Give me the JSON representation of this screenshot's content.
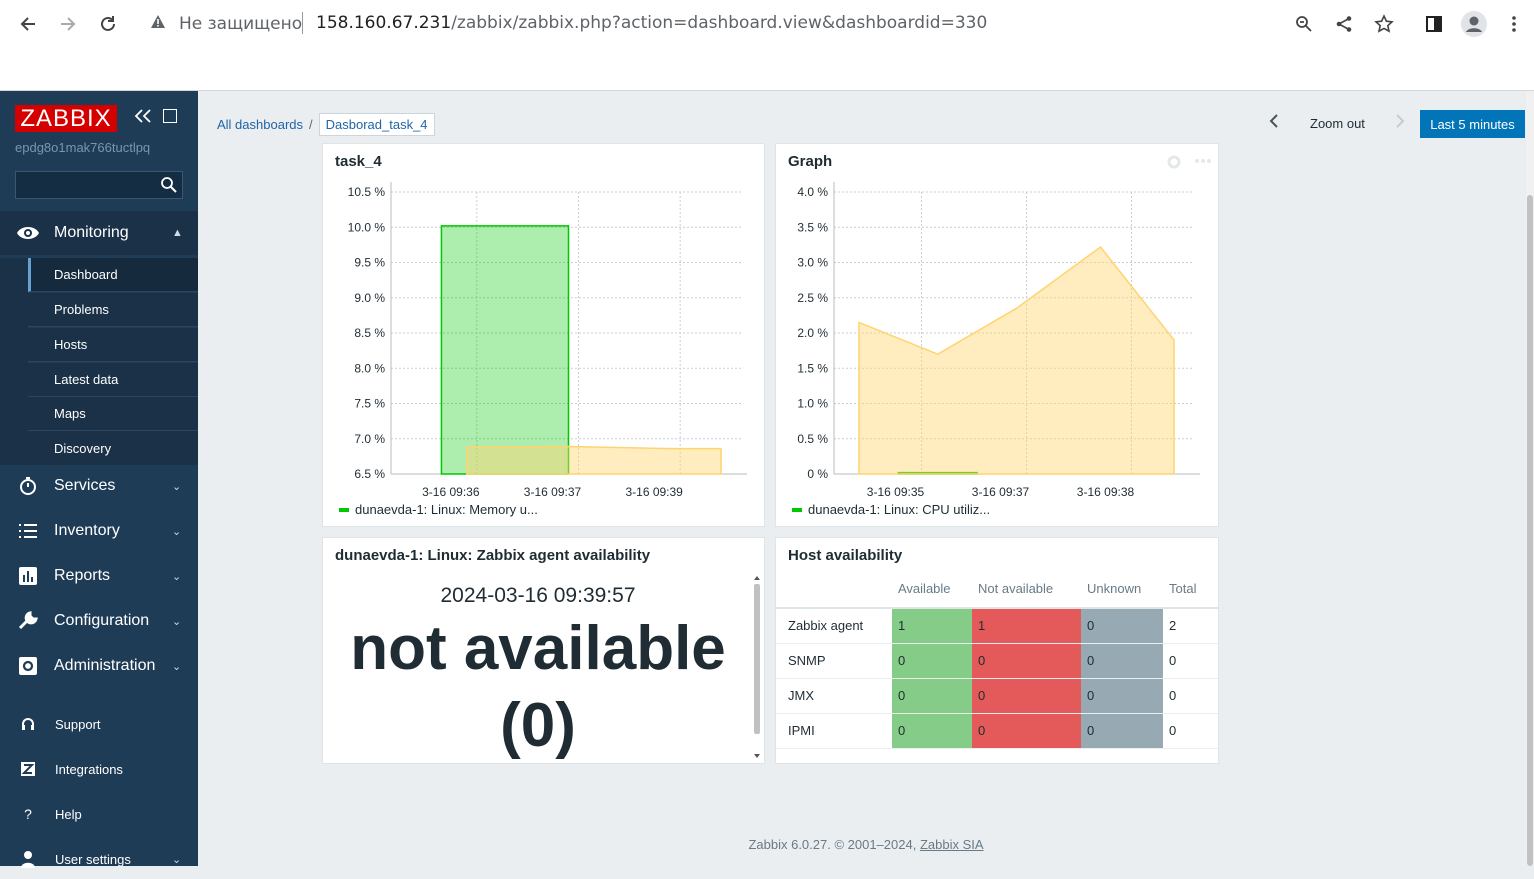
{
  "browser": {
    "insecure_label": "Не защищено",
    "url_host": "158.160.67.231",
    "url_path": "/zabbix/zabbix.php?action=dashboard.view&dashboardid=330"
  },
  "sidebar": {
    "logo": "ZABBIX",
    "server_name": "epdg8o1mak766tuctlpq",
    "search_value": "",
    "sections": [
      {
        "label": "Monitoring",
        "icon": "eye-icon"
      },
      {
        "label": "Services",
        "icon": "stopwatch-icon"
      },
      {
        "label": "Inventory",
        "icon": "list-icon"
      },
      {
        "label": "Reports",
        "icon": "bar-chart-icon"
      },
      {
        "label": "Configuration",
        "icon": "wrench-icon"
      },
      {
        "label": "Administration",
        "icon": "gear-icon"
      }
    ],
    "monitoring_items": [
      "Dashboard",
      "Problems",
      "Hosts",
      "Latest data",
      "Maps",
      "Discovery"
    ],
    "bottom_items": [
      {
        "label": "Support",
        "icon": "headset-icon"
      },
      {
        "label": "Integrations",
        "icon": "z-icon"
      },
      {
        "label": "Help",
        "icon": "question-icon"
      },
      {
        "label": "User settings",
        "icon": "user-icon"
      }
    ]
  },
  "header": {
    "breadcrumb_root": "All dashboards",
    "breadcrumb_current": "Dasborad_task_4",
    "zoom_out": "Zoom out",
    "time_range": "Last 5 minutes"
  },
  "widgets": {
    "task4": {
      "title": "task_4",
      "legend": "dunaevda-1: Linux: Memory u..."
    },
    "graph": {
      "title": "Graph",
      "legend": "dunaevda-1: Linux: CPU utiliz..."
    },
    "agent": {
      "title": "dunaevda-1: Linux: Zabbix agent availability",
      "timestamp": "2024-03-16 09:39:57",
      "value": "not available",
      "code": "(0)"
    },
    "host_availability": {
      "title": "Host availability",
      "columns": [
        "",
        "Available",
        "Not available",
        "Unknown",
        "Total"
      ],
      "rows": [
        {
          "name": "Zabbix agent",
          "available": "1",
          "not_available": "1",
          "unknown": "0",
          "total": "2"
        },
        {
          "name": "SNMP",
          "available": "0",
          "not_available": "0",
          "unknown": "0",
          "total": "0"
        },
        {
          "name": "JMX",
          "available": "0",
          "not_available": "0",
          "unknown": "0",
          "total": "0"
        },
        {
          "name": "IPMI",
          "available": "0",
          "not_available": "0",
          "unknown": "0",
          "total": "0"
        }
      ]
    }
  },
  "chart_data": [
    {
      "type": "area",
      "title": "task_4",
      "y_ticks": [
        "10.5 %",
        "10.0 %",
        "9.5 %",
        "9.0 %",
        "8.5 %",
        "8.0 %",
        "7.5 %",
        "7.0 %",
        "6.5 %"
      ],
      "x_ticks": [
        "3-16 09:36",
        "3-16 09:37",
        "3-16 09:39"
      ],
      "ylim": [
        6.5,
        10.5
      ],
      "series": [
        {
          "name": "dunaevda-1: Linux: Memory u...",
          "color": "#00c800",
          "x": [
            0.1,
            0.6
          ],
          "values": [
            10.02,
            10.02
          ]
        },
        {
          "color": "#ffd470",
          "x": [
            0.2,
            0.6,
            1.0,
            1.2
          ],
          "values": [
            6.88,
            6.89,
            6.86,
            6.86
          ]
        }
      ]
    },
    {
      "type": "area",
      "title": "Graph",
      "y_ticks": [
        "4.0 %",
        "3.5 %",
        "3.0 %",
        "2.5 %",
        "2.0 %",
        "1.5 %",
        "1.0 %",
        "0.5 %",
        "0 %"
      ],
      "x_ticks": [
        "3-16 09:35",
        "3-16 09:37",
        "3-16 09:38"
      ],
      "ylim": [
        0,
        4
      ],
      "series": [
        {
          "name": "dunaevda-1: Linux: CPU utiliz...",
          "color": "#00c800",
          "x": [
            0.15,
            0.45
          ],
          "values": [
            0.02,
            0.02
          ]
        },
        {
          "color": "#ffd470",
          "x": [
            0,
            0.3,
            0.6,
            0.92,
            1.2
          ],
          "values": [
            2.15,
            1.7,
            2.35,
            3.22,
            1.9
          ]
        }
      ]
    }
  ],
  "footer": {
    "text": "Zabbix 6.0.27. © 2001–2024, ",
    "link": "Zabbix SIA"
  }
}
